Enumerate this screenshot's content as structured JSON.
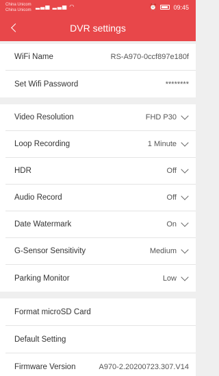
{
  "status_bar": {
    "carrier_1": "China Unicom",
    "carrier_2": "China Unicom",
    "signal_icons": "¹ˡᴴᴸ ıll ıll",
    "status_icons": "✳ ⏰ ⨯",
    "time": "09:45"
  },
  "header": {
    "title": "DVR settings"
  },
  "groups": [
    {
      "items": [
        {
          "label": "WiFi Name",
          "value": "RS-A970-0ccf897e180f"
        },
        {
          "label": "Set Wifi Password",
          "value": "********"
        }
      ]
    },
    {
      "items": [
        {
          "label": "Video Resolution",
          "value": "FHD P30"
        },
        {
          "label": "Loop Recording",
          "value": "1 Minute"
        },
        {
          "label": "HDR",
          "value": "Off"
        },
        {
          "label": "Audio Record",
          "value": "Off"
        },
        {
          "label": "Date Watermark",
          "value": "On"
        },
        {
          "label": "G-Sensor Sensitivity",
          "value": "Medium"
        },
        {
          "label": "Parking Monitor",
          "value": "Low"
        }
      ]
    },
    {
      "items": [
        {
          "label": "Format microSD Card",
          "value": ""
        },
        {
          "label": "Default Setting",
          "value": ""
        },
        {
          "label": "Firmware Version",
          "value": "A970-2.20200723.307.V14"
        }
      ]
    }
  ]
}
